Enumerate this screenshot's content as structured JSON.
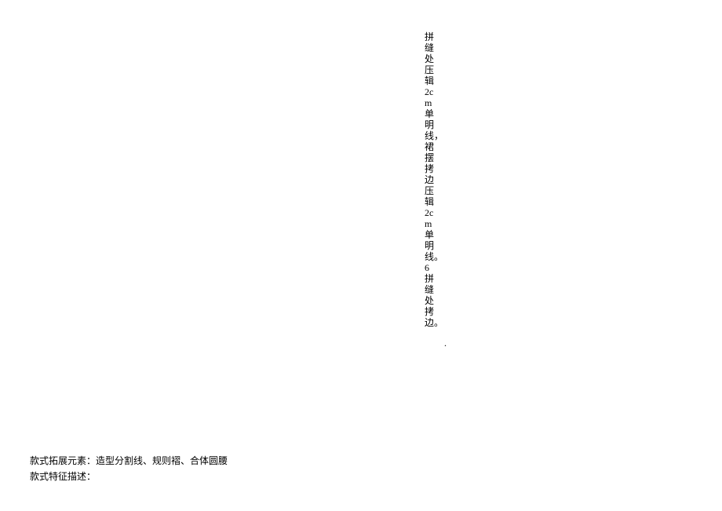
{
  "vertical": {
    "columnA": "拼缝处压辑2cm单明线，裙摆拷边压辑2cm单明线。6拼缝处拷边。",
    "columnB": "."
  },
  "bottom": {
    "line1_label": "款式拓展元素：",
    "line1_value": "造型分割线、规则褶、合体圆腰",
    "line2_label": "款式特征描述："
  }
}
